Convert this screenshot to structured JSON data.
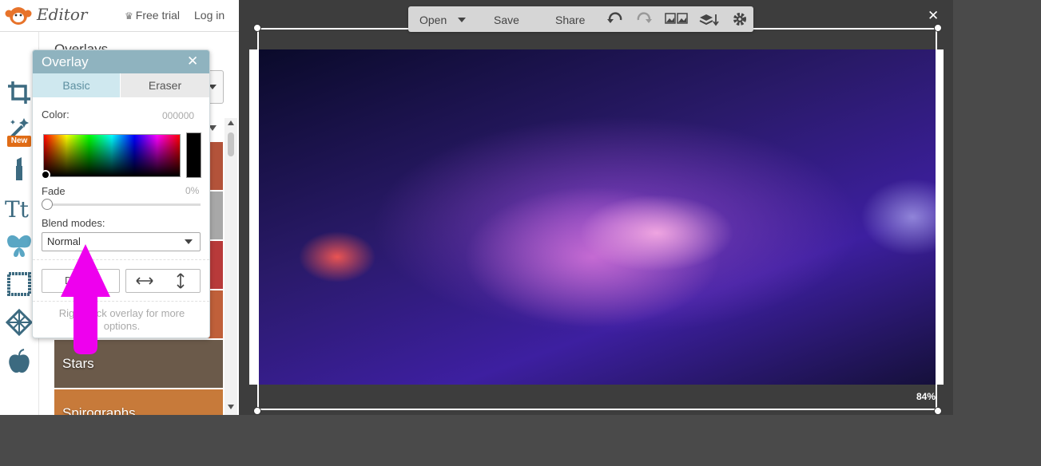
{
  "app": {
    "title": "Editor",
    "free_trial": "Free trial",
    "login": "Log in",
    "new_badge": "New"
  },
  "sidebar": {
    "heading": "Overlays",
    "thumbnails": [
      {
        "label": "",
        "color": "#b3533a"
      },
      {
        "label": "",
        "color": "#a8a8a8"
      },
      {
        "label": "",
        "color": "#b83a3a"
      },
      {
        "label": "",
        "color": "#c0603a"
      },
      {
        "label": "Stars",
        "color": "#6b5a4a"
      },
      {
        "label": "Spirographs",
        "color": "#c77a3a"
      }
    ]
  },
  "overlay_panel": {
    "title": "Overlay",
    "tabs": {
      "basic": "Basic",
      "eraser": "Eraser"
    },
    "color_label": "Color:",
    "color_hex": "000000",
    "fade_label": "Fade",
    "fade_value": "0%",
    "blend_label": "Blend modes:",
    "blend_value": "Normal",
    "duplicate_label": "Du",
    "help": "Right-click overlay for more options."
  },
  "toolbar": {
    "open": "Open",
    "save": "Save",
    "share": "Share"
  },
  "canvas": {
    "zoom": "84%"
  },
  "colors": {
    "panel_header": "#8fb3bf",
    "tab_active": "#cfe8ef",
    "arrow": "#ee00ee"
  }
}
